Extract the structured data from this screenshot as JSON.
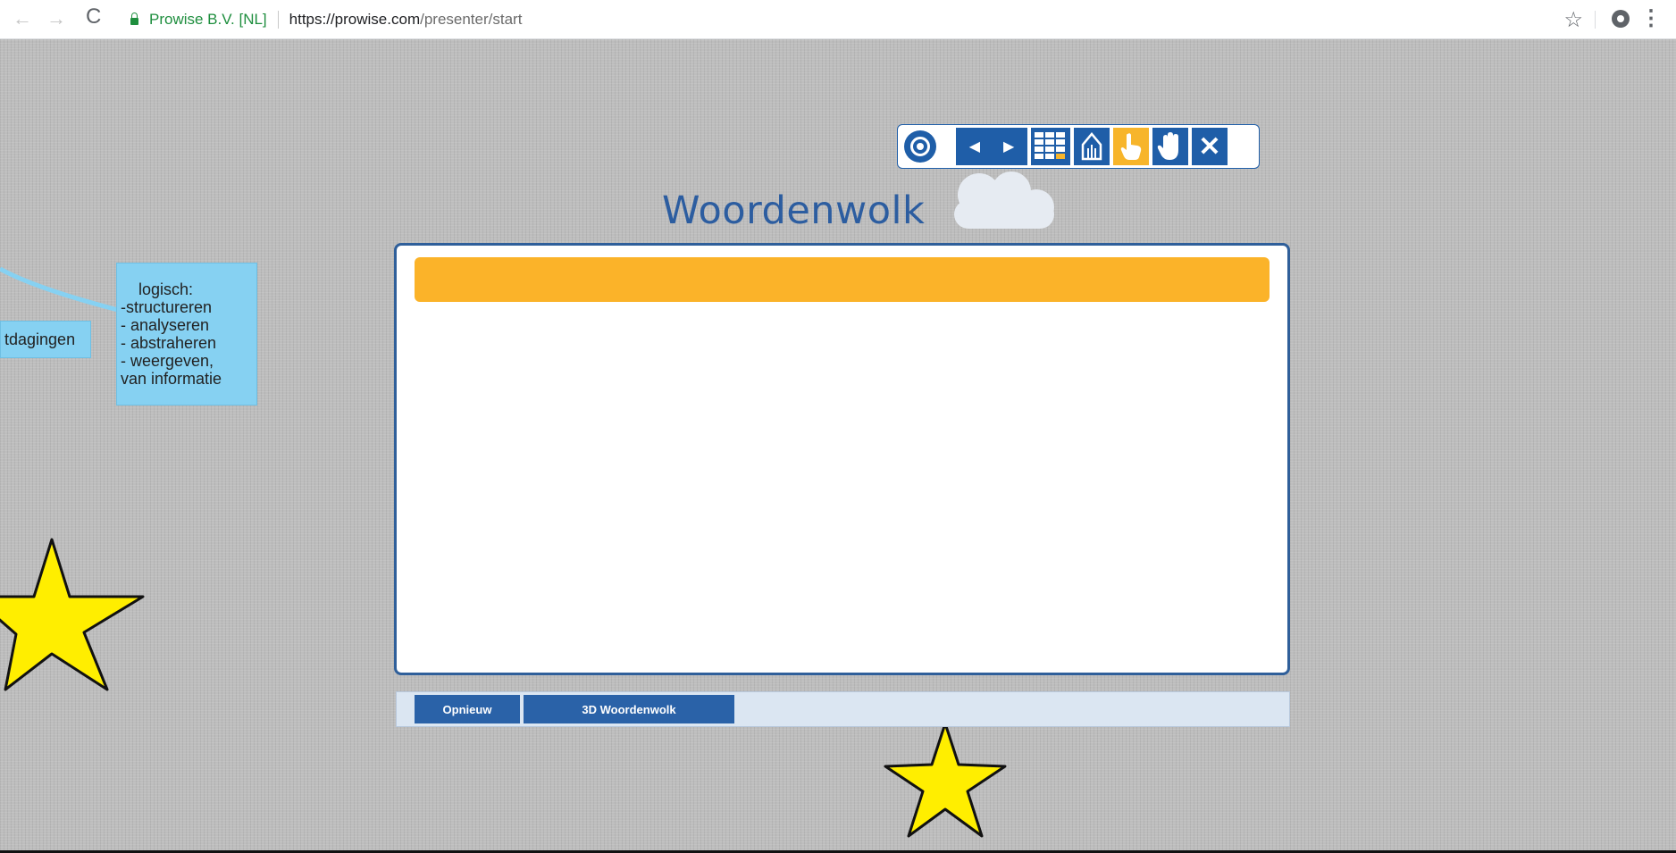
{
  "browser": {
    "site_name": "Prowise B.V. [NL]",
    "url_host": "https://prowise.com",
    "url_path": "/presenter/start",
    "back_glyph": "←",
    "forward_glyph": "→",
    "reload_glyph": "C",
    "bookmark_glyph": "☆",
    "menu_glyph": "⋮"
  },
  "mindmap": {
    "left_node": "tdagingen",
    "right_node_lines": [
      "logisch:",
      "-structureren",
      "- analyseren",
      "- abstraheren",
      "- weergeven,",
      "van informatie"
    ]
  },
  "toolbar": {
    "prev_glyph": "◀",
    "next_glyph": "▶",
    "close_glyph": "✕",
    "icons": [
      "prowise-logo-icon",
      "previous-icon",
      "next-icon",
      "grid-icon",
      "pen-icon",
      "pointer-icon",
      "hand-icon",
      "close-icon"
    ]
  },
  "widget": {
    "title": "Woordenwolk",
    "input_value": "",
    "buttons": {
      "again": "Opnieuw",
      "threed": "3D Woordenwolk"
    }
  },
  "colors": {
    "accent_blue": "#1f5ea8",
    "accent_orange": "#fbb329",
    "node_blue": "#86d1f2",
    "star_yellow": "#ffee00"
  }
}
